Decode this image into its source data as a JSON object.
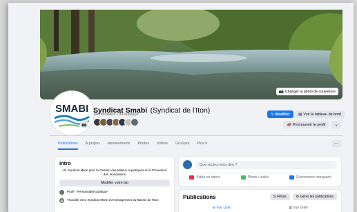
{
  "cover": {
    "change_button_label": "Changer la photo de couverture",
    "camera_icon": "camera-icon"
  },
  "profile": {
    "logo_text": "SMABI",
    "name": "Syndicat Smabi",
    "subtitle": "(Syndicat de l'Iton)",
    "followers": "248 followers • 34 suivi(e)s"
  },
  "actions": {
    "edit_label": "Modifier",
    "dashboard_label": "Voir le tableau de bord",
    "promote_label": "Promouvoir le profil",
    "more_icon": "chevron-down-icon"
  },
  "tabs": [
    {
      "label": "Publications",
      "active": true
    },
    {
      "label": "À propos"
    },
    {
      "label": "Abonnements"
    },
    {
      "label": "Photos"
    },
    {
      "label": "Vidéos"
    },
    {
      "label": "Groupes"
    },
    {
      "label": "Plus ▾"
    }
  ],
  "tabs_more_label": "···",
  "intro": {
    "title": "Intro",
    "description": "Un Syndicat Mixte pour la Gestion des Milieux Aquatiques et la Prévention des Inondations",
    "edit_bio_label": "Modifier votre bio",
    "rows": [
      {
        "icon": "info-icon",
        "text": "Profil · Personnalité publique"
      },
      {
        "icon": "building-icon",
        "text": "Travaille chez Syndicat Mixte d'Aménagement du Bassin de l'Iton"
      }
    ]
  },
  "composer": {
    "placeholder": "Que voulez-vous dire ?",
    "actions": [
      {
        "label": "Vidéo en direct",
        "icon": "live-video-icon",
        "color": "#f02849"
      },
      {
        "label": "Photo / vidéo",
        "icon": "photo-icon",
        "color": "#45bd62"
      },
      {
        "label": "Événement marquant",
        "icon": "flag-icon",
        "color": "#1877f2"
      }
    ]
  },
  "posts": {
    "title": "Publications",
    "filters_label": "⇅ Filtres",
    "manage_label": "⚙ Gérer les publications",
    "views": [
      {
        "label": "☰ Vue Liste",
        "active": true
      },
      {
        "label": "▦ Vue Grille"
      }
    ]
  },
  "colors": {
    "accent": "#1877f2",
    "background": "#f0f2f5",
    "button_grey": "#e4e6eb"
  }
}
